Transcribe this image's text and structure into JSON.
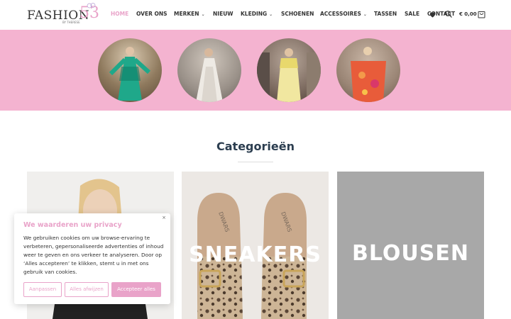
{
  "header": {
    "logo": {
      "text": "FASHION",
      "number": "53",
      "sub": "BY THERESE"
    },
    "nav": [
      {
        "label": "HOME",
        "active": true,
        "caret": false
      },
      {
        "label": "OVER ONS",
        "active": false,
        "caret": false
      },
      {
        "label": "MERKEN",
        "active": false,
        "caret": true
      },
      {
        "label": "NIEUW",
        "active": false,
        "caret": false
      },
      {
        "label": "KLEDING",
        "active": false,
        "caret": true
      },
      {
        "label": "SCHOENEN",
        "active": false,
        "caret": false
      },
      {
        "label": "ACCESSOIRES",
        "active": false,
        "caret": true
      },
      {
        "label": "TASSEN",
        "active": false,
        "caret": false
      },
      {
        "label": "SALE",
        "active": false,
        "caret": false
      },
      {
        "label": "CONTACT",
        "active": false,
        "caret": false
      }
    ],
    "cart_amount": "€ 0,00",
    "icons": [
      "heart-icon",
      "search-icon",
      "cart-icon"
    ],
    "caret_glyph": "⌄"
  },
  "banner": {
    "color": "#f4b3d0",
    "images": [
      "outfit-photo-1",
      "outfit-photo-2",
      "outfit-photo-3",
      "outfit-photo-4"
    ]
  },
  "categories": {
    "title": "Categorieën",
    "cards": [
      {
        "label": "",
        "image": "model-photo"
      },
      {
        "label": "SNEAKERS",
        "image": "leopard-sneakers-photo"
      },
      {
        "label": "BLOUSEN",
        "image": "grey-placeholder"
      }
    ]
  },
  "cookie": {
    "title": "We waarderen uw privacy",
    "close": "×",
    "body": "We gebruiken cookies om uw browse-ervaring te verbeteren, gepersonaliseerde advertenties of inhoud weer te geven en ons verkeer te analyseren. Door op ‘Alles accepteren’ te klikken, stemt u in met ons gebruik van cookies.",
    "buttons": {
      "customize": "Aanpassen",
      "reject": "Alles afwijzen",
      "accept": "Accepteer alles"
    }
  },
  "colors": {
    "accent": "#e9a3c9",
    "title": "#2c3e50"
  }
}
